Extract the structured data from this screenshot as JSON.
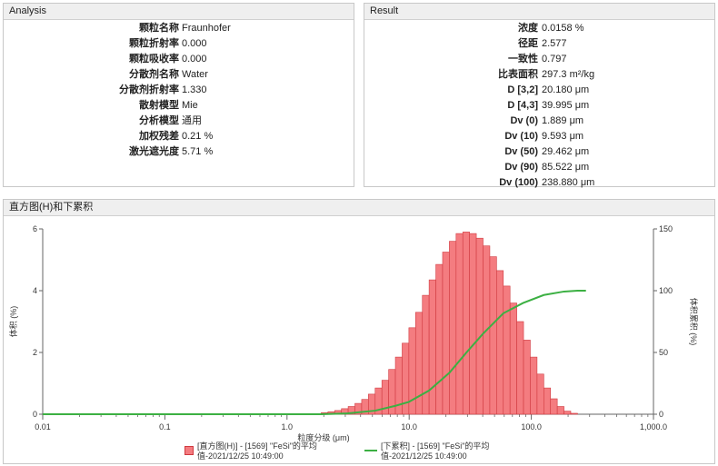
{
  "analysis": {
    "title": "Analysis",
    "rows": [
      {
        "key": "颗粒名称",
        "value": "Fraunhofer"
      },
      {
        "key": "颗粒折射率",
        "value": "0.000"
      },
      {
        "key": "颗粒吸收率",
        "value": "0.000"
      },
      {
        "key": "分散剂名称",
        "value": "Water"
      },
      {
        "key": "分散剂折射率",
        "value": "1.330"
      },
      {
        "key": "散射模型",
        "value": "Mie"
      },
      {
        "key": "分析模型",
        "value": "通用"
      },
      {
        "key": "加权残差",
        "value": "0.21 %"
      },
      {
        "key": "激光遮光度",
        "value": "5.71 %"
      }
    ]
  },
  "result": {
    "title": "Result",
    "rows": [
      {
        "key": "浓度",
        "value": "0.0158 %"
      },
      {
        "key": "径距",
        "value": "2.577"
      },
      {
        "key": "一致性",
        "value": "0.797"
      },
      {
        "key": "比表面积",
        "value": "297.3 m²/kg"
      },
      {
        "key": "D [3,2]",
        "value": "20.180 μm"
      },
      {
        "key": "D [4,3]",
        "value": "39.995 μm"
      },
      {
        "key": "Dv (0)",
        "value": "1.889 μm"
      },
      {
        "key": "Dv (10)",
        "value": "9.593 μm"
      },
      {
        "key": "Dv (50)",
        "value": "29.462 μm"
      },
      {
        "key": "Dv (90)",
        "value": "85.522 μm"
      },
      {
        "key": "Dv (100)",
        "value": "238.880 μm"
      }
    ]
  },
  "chart_panel": {
    "title": "直方图(H)和下累积"
  },
  "legend": {
    "histogram": "[直方图(H)] - [1569] \"FeSi\"的平均值-2021/12/25 10:49:00",
    "cumulative": "[下累积] - [1569] \"FeSi\"的平均值-2021/12/25 10:49:00"
  },
  "chart_data": {
    "type": "bar",
    "xscale": "log",
    "xlabel": "粒度分级 (μm)",
    "ylabel": "体积 (%)",
    "y2label": "体积累积 (%)",
    "xlim": [
      0.01,
      1000
    ],
    "ylim": [
      0,
      6
    ],
    "y2lim": [
      0,
      150
    ],
    "xticks": [
      0.01,
      0.1,
      1.0,
      10.0,
      100.0,
      1000.0
    ],
    "xtick_labels": [
      "0.01",
      "0.1",
      "1.0",
      "10.0",
      "100.0",
      "1,000.0"
    ],
    "yticks": [
      0,
      2,
      4,
      6
    ],
    "y2ticks": [
      0,
      50,
      100,
      150
    ],
    "histogram_color": "#f47c80",
    "histogram_edge": "#d03a40",
    "cumulative_color": "#3cb043",
    "series": [
      {
        "name": "[直方图(H)] - [1569] \"FeSi\"的平均值-2021/12/25 10:49:00",
        "kind": "histogram",
        "bin_edges": [
          1.905,
          2.163,
          2.456,
          2.789,
          3.167,
          3.597,
          4.084,
          4.638,
          5.267,
          5.981,
          6.792,
          7.713,
          8.758,
          9.946,
          11.29,
          12.83,
          14.56,
          16.54,
          18.78,
          21.33,
          24.22,
          27.5,
          31.23,
          35.46,
          40.27,
          45.73,
          51.93,
          58.97,
          66.96,
          76.04,
          86.35,
          98.06,
          111.4,
          126.5,
          143.6,
          163.1,
          185.2,
          210.3,
          238.8
        ],
        "values": [
          0.05,
          0.08,
          0.12,
          0.18,
          0.25,
          0.35,
          0.48,
          0.65,
          0.85,
          1.1,
          1.45,
          1.85,
          2.3,
          2.8,
          3.3,
          3.85,
          4.35,
          4.85,
          5.25,
          5.6,
          5.85,
          5.9,
          5.85,
          5.7,
          5.45,
          5.1,
          4.65,
          4.15,
          3.6,
          3.0,
          2.4,
          1.85,
          1.3,
          0.85,
          0.5,
          0.25,
          0.1,
          0.03
        ]
      },
      {
        "name": "[下累积] - [1569] \"FeSi\"的平均值-2021/12/25 10:49:00",
        "kind": "cumulative",
        "x": [
          0.01,
          1.905,
          3.167,
          5.267,
          7.713,
          9.946,
          14.56,
          21.33,
          29.46,
          40.27,
          58.97,
          85.52,
          126.5,
          185.2,
          238.8,
          280
        ],
        "y": [
          0,
          0,
          0.7,
          2.9,
          6.8,
          10.0,
          19.2,
          33.5,
          50.0,
          65.2,
          81.7,
          90.0,
          96.5,
          99.3,
          100,
          100
        ]
      }
    ]
  }
}
